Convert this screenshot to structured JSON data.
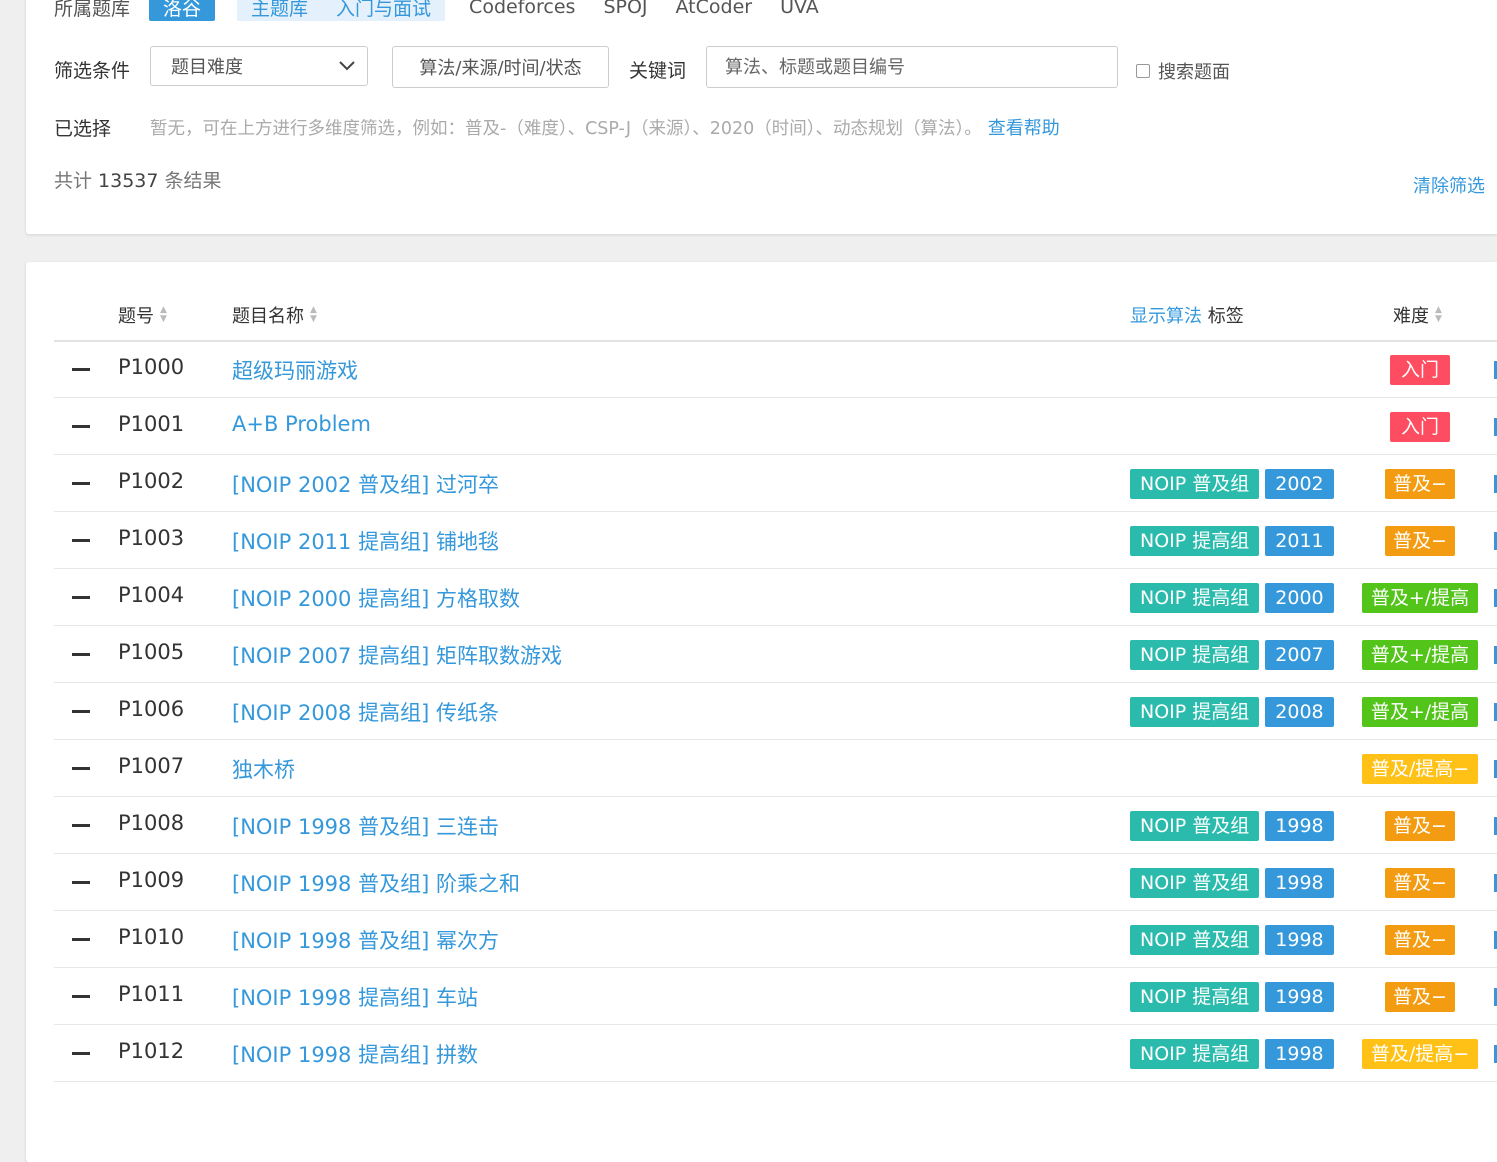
{
  "filter": {
    "source_label": "所属题库",
    "source_tabs": [
      "洛谷",
      "主题库",
      "入门与面试",
      "Codeforces",
      "SPOJ",
      "AtCoder",
      "UVA"
    ],
    "condition_label": "筛选条件",
    "difficulty_select": "题目难度",
    "algo_filter_button": "算法/来源/时间/状态",
    "keyword_label": "关键词",
    "keyword_placeholder": "算法、标题或题目编号",
    "search_content_label": "搜索题面",
    "selected_label": "已选择",
    "selected_hint": "暂无，可在上方进行多维度筛选，例如：普及-（难度）、CSP-J（来源）、2020（时间）、动态规划（算法）。",
    "help_link": "查看帮助",
    "total_prefix": "共计",
    "total_count": "13537",
    "total_suffix": "条结果",
    "clear_link": "清除筛选"
  },
  "table": {
    "col_id": "题号",
    "col_title": "题目名称",
    "col_tags_link": "显示算法",
    "col_tags": "标签",
    "col_difficulty": "难度",
    "rows": [
      {
        "id": "P1000",
        "title": "超级玛丽游戏",
        "src": "",
        "year": "",
        "diff": "入门",
        "diff_color": "#fe4c61"
      },
      {
        "id": "P1001",
        "title": "A+B Problem",
        "src": "",
        "year": "",
        "diff": "入门",
        "diff_color": "#fe4c61"
      },
      {
        "id": "P1002",
        "title": "[NOIP 2002 普及组] 过河卒",
        "src": "NOIP 普及组",
        "year": "2002",
        "diff": "普及−",
        "diff_color": "#f39c11"
      },
      {
        "id": "P1003",
        "title": "[NOIP 2011 提高组] 铺地毯",
        "src": "NOIP 提高组",
        "year": "2011",
        "diff": "普及−",
        "diff_color": "#f39c11"
      },
      {
        "id": "P1004",
        "title": "[NOIP 2000 提高组] 方格取数",
        "src": "NOIP 提高组",
        "year": "2000",
        "diff": "普及+/提高",
        "diff_color": "#52c41a"
      },
      {
        "id": "P1005",
        "title": "[NOIP 2007 提高组] 矩阵取数游戏",
        "src": "NOIP 提高组",
        "year": "2007",
        "diff": "普及+/提高",
        "diff_color": "#52c41a"
      },
      {
        "id": "P1006",
        "title": "[NOIP 2008 提高组] 传纸条",
        "src": "NOIP 提高组",
        "year": "2008",
        "diff": "普及+/提高",
        "diff_color": "#52c41a"
      },
      {
        "id": "P1007",
        "title": "独木桥",
        "src": "",
        "year": "",
        "diff": "普及/提高−",
        "diff_color": "#ffc116"
      },
      {
        "id": "P1008",
        "title": "[NOIP 1998 普及组] 三连击",
        "src": "NOIP 普及组",
        "year": "1998",
        "diff": "普及−",
        "diff_color": "#f39c11"
      },
      {
        "id": "P1009",
        "title": "[NOIP 1998 普及组] 阶乘之和",
        "src": "NOIP 普及组",
        "year": "1998",
        "diff": "普及−",
        "diff_color": "#f39c11"
      },
      {
        "id": "P1010",
        "title": "[NOIP 1998 普及组] 幂次方",
        "src": "NOIP 普及组",
        "year": "1998",
        "diff": "普及−",
        "diff_color": "#f39c11"
      },
      {
        "id": "P1011",
        "title": "[NOIP 1998 提高组] 车站",
        "src": "NOIP 提高组",
        "year": "1998",
        "diff": "普及−",
        "diff_color": "#f39c11"
      },
      {
        "id": "P1012",
        "title": "[NOIP 1998 提高组] 拼数",
        "src": "NOIP 提高组",
        "year": "1998",
        "diff": "普及/提高−",
        "diff_color": "#ffc116"
      }
    ]
  },
  "colors": {
    "link": "#3498db",
    "source_tag": "#2bbbad",
    "year_tag": "#3498db"
  }
}
